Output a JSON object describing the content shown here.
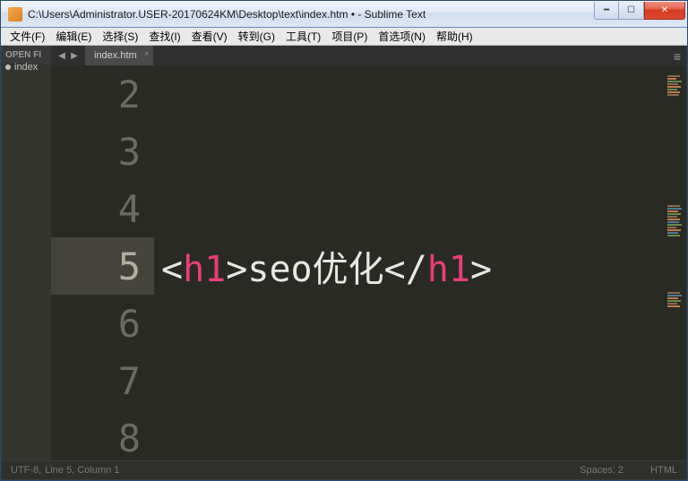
{
  "window": {
    "title": "C:\\Users\\Administrator.USER-20170624KM\\Desktop\\text\\index.htm • - Sublime Text"
  },
  "menu": {
    "file": "文件(F)",
    "edit": "编辑(E)",
    "select": "选择(S)",
    "find": "查找(I)",
    "view": "查看(V)",
    "goto": "转到(G)",
    "tools": "工具(T)",
    "project": "项目(P)",
    "prefs": "首选项(N)",
    "help": "帮助(H)"
  },
  "openfiles": {
    "header": "OPEN FI",
    "entry": "index"
  },
  "tabs": {
    "tab1": "index.htm"
  },
  "editor": {
    "lines": {
      "l2": "2",
      "l3": "3",
      "l4": "4",
      "l5": "5",
      "l6": "6",
      "l7": "7",
      "l8": "8"
    },
    "code": {
      "open_br": "<",
      "tag": "h1",
      "close_br": ">",
      "text": "seo优化",
      "open_end": "</",
      "end_close": ">"
    }
  },
  "status": {
    "encoding": "UTF-8,",
    "position": "Line 5, Column 1",
    "spaces": "Spaces: 2",
    "syntax": "HTML"
  }
}
